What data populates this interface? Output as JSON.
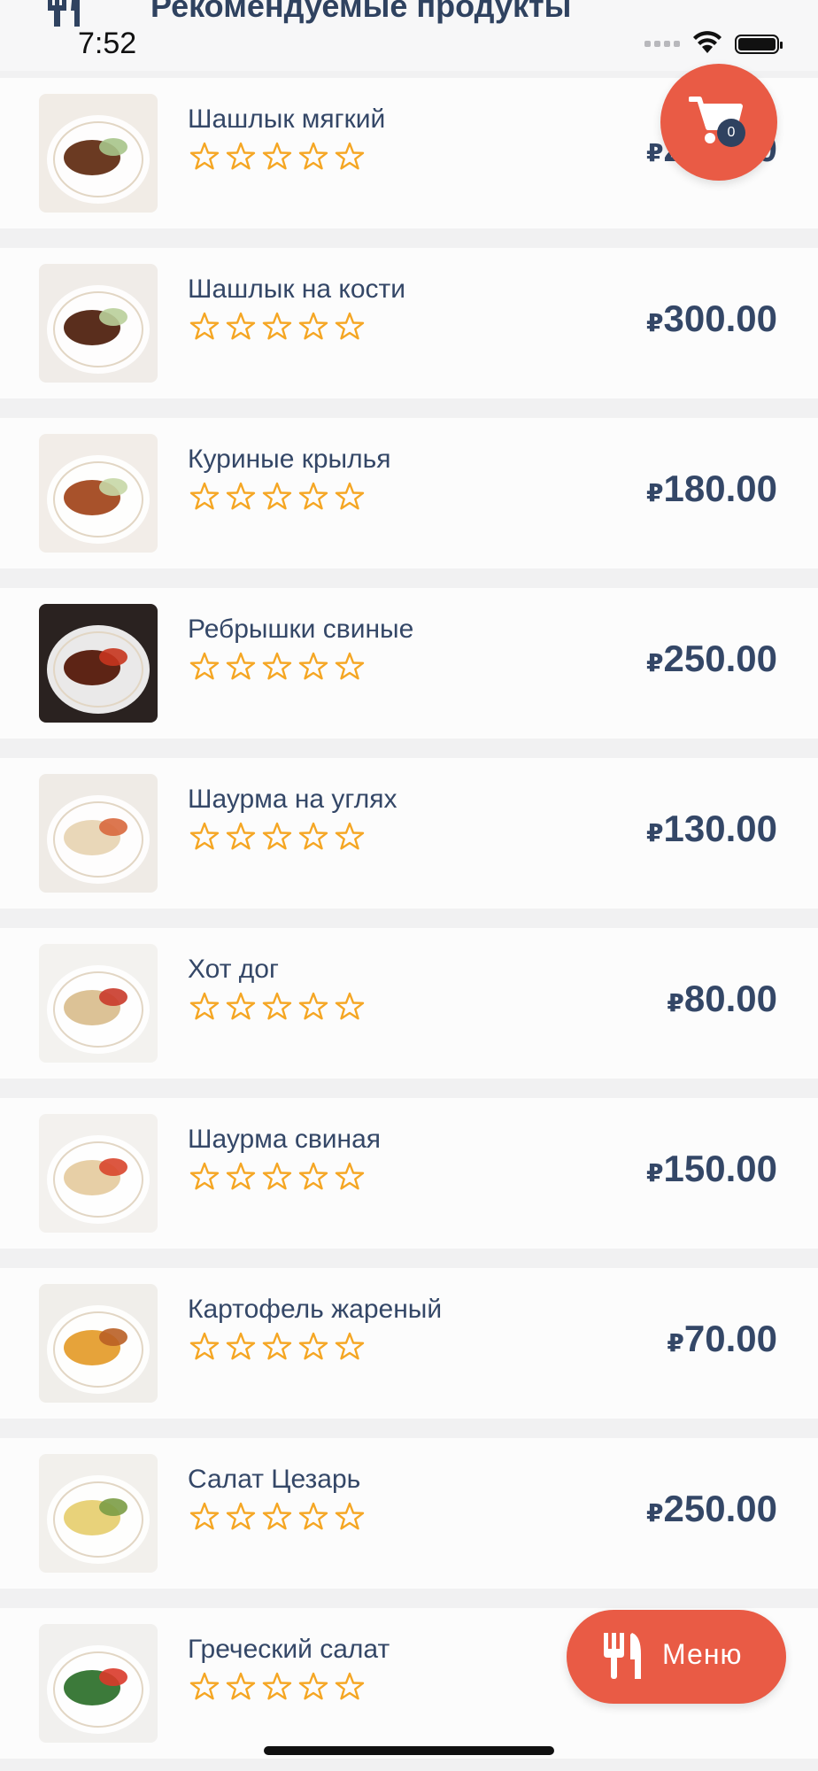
{
  "status_bar": {
    "time": "7:52"
  },
  "header": {
    "title": "Рекомендуемые продукты"
  },
  "cart": {
    "count": "0"
  },
  "menu_button": {
    "label": "Меню"
  },
  "colors": {
    "accent": "#e95b45",
    "text": "#344767",
    "star": "#f5a623"
  },
  "products": [
    {
      "name": "Шашлык мягкий",
      "currency": "₽",
      "price": "250.00",
      "rating": 0
    },
    {
      "name": "Шашлык на кости",
      "currency": "₽",
      "price": "300.00",
      "rating": 0
    },
    {
      "name": "Куриные крылья",
      "currency": "₽",
      "price": "180.00",
      "rating": 0
    },
    {
      "name": "Ребрышки свиные",
      "currency": "₽",
      "price": "250.00",
      "rating": 0
    },
    {
      "name": "Шаурма на углях",
      "currency": "₽",
      "price": "130.00",
      "rating": 0
    },
    {
      "name": "Хот дог",
      "currency": "₽",
      "price": "80.00",
      "rating": 0
    },
    {
      "name": "Шаурма свиная",
      "currency": "₽",
      "price": "150.00",
      "rating": 0
    },
    {
      "name": "Картофель жареный",
      "currency": "₽",
      "price": "70.00",
      "rating": 0
    },
    {
      "name": "Салат Цезарь",
      "currency": "₽",
      "price": "250.00",
      "rating": 0
    },
    {
      "name": "Греческий салат",
      "currency": "₽",
      "price": "",
      "rating": 0
    }
  ]
}
